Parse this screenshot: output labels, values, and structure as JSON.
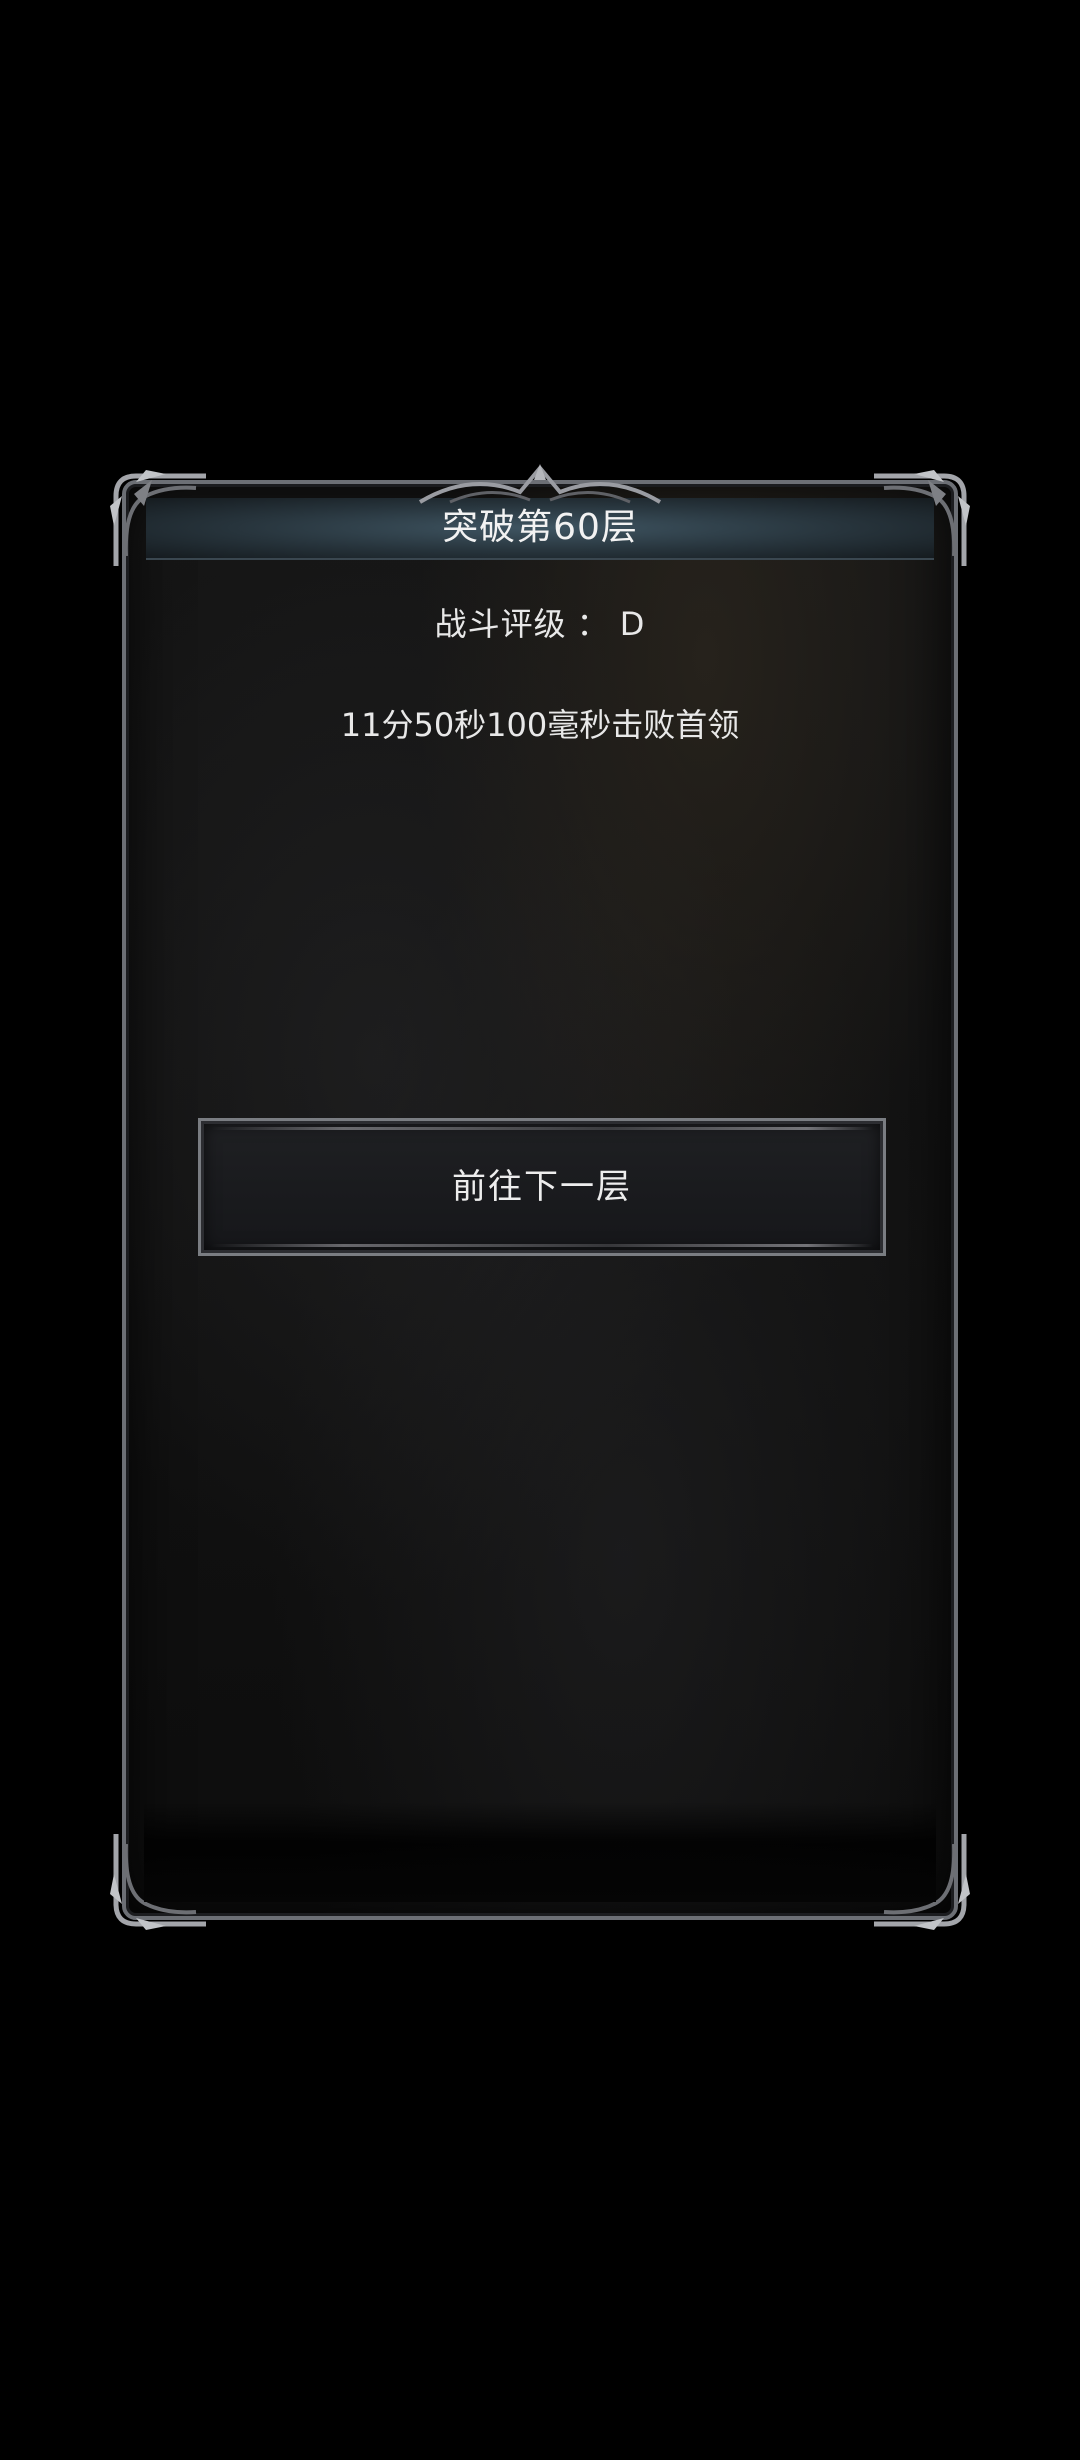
{
  "dialog": {
    "title": "突破第60层",
    "rating_label": "战斗评级",
    "rating_separator": "：",
    "rating_value": "D",
    "result_text": "11分50秒100毫秒击败首领",
    "next_button_label": "前往下一层"
  },
  "colors": {
    "background": "#000000",
    "panel": "#121212",
    "title_bar": "#2f3f48",
    "frame": "#6c6f75",
    "text": "#e8e8e8"
  },
  "icons": {
    "corner_ornament": "gothic-corner-ornament-icon",
    "top_ornament": "gothic-crest-ornament-icon"
  }
}
